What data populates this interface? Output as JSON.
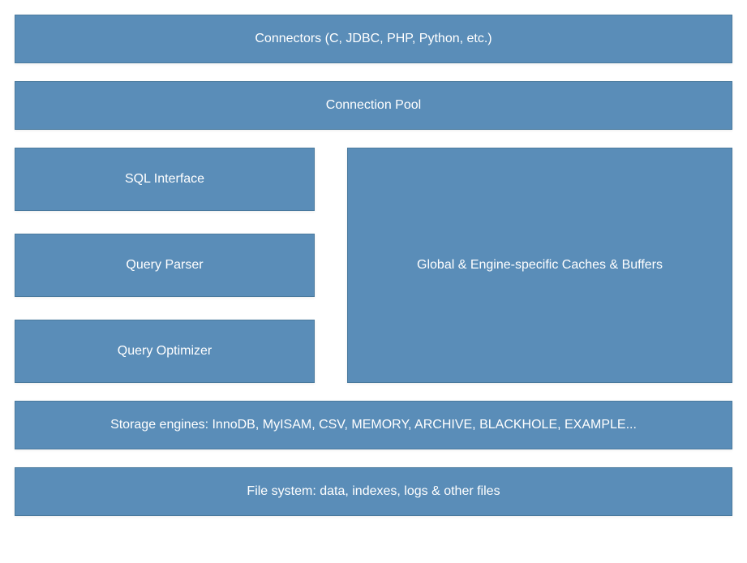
{
  "connectors": "Connectors (C, JDBC, PHP, Python, etc.)",
  "connection_pool": "Connection Pool",
  "sql_interface": "SQL Interface",
  "query_parser": "Query Parser",
  "query_optimizer": "Query Optimizer",
  "caches_buffers": "Global & Engine-specific Caches & Buffers",
  "storage_engines": "Storage engines: InnoDB, MyISAM, CSV, MEMORY, ARCHIVE, BLACKHOLE, EXAMPLE...",
  "file_system": "File system: data, indexes, logs & other files"
}
